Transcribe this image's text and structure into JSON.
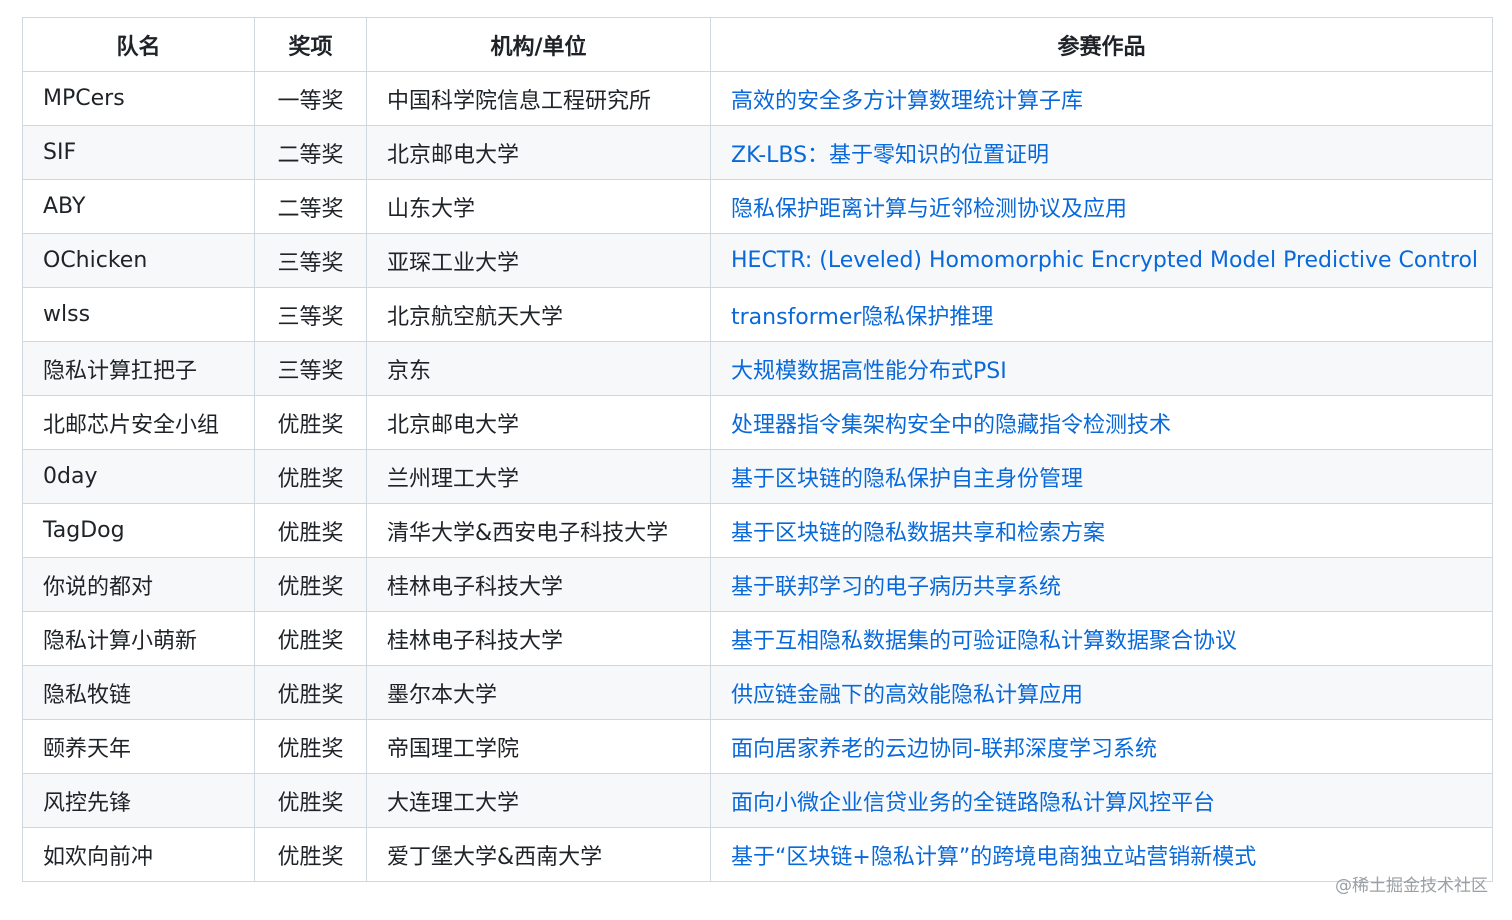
{
  "table": {
    "headers": [
      "队名",
      "奖项",
      "机构/单位",
      "参赛作品"
    ],
    "rows": [
      {
        "team": "MPCers",
        "award": "一等奖",
        "org": "中国科学院信息工程研究所",
        "work": "高效的安全多方计算数理统计算子库"
      },
      {
        "team": "SIF",
        "award": "二等奖",
        "org": "北京邮电大学",
        "work": "ZK-LBS：基于零知识的位置证明"
      },
      {
        "team": "ABY",
        "award": "二等奖",
        "org": "山东大学",
        "work": "隐私保护距离计算与近邻检测协议及应用"
      },
      {
        "team": "OChicken",
        "award": "三等奖",
        "org": "亚琛工业大学",
        "work": "HECTR: (Leveled) Homomorphic Encrypted Model Predictive Control"
      },
      {
        "team": "wlss",
        "award": "三等奖",
        "org": "北京航空航天大学",
        "work": "transformer隐私保护推理"
      },
      {
        "team": "隐私计算扛把子",
        "award": "三等奖",
        "org": "京东",
        "work": "大规模数据高性能分布式PSI"
      },
      {
        "team": "北邮芯片安全小组",
        "award": "优胜奖",
        "org": "北京邮电大学",
        "work": "处理器指令集架构安全中的隐藏指令检测技术"
      },
      {
        "team": "0day",
        "award": "优胜奖",
        "org": "兰州理工大学",
        "work": "基于区块链的隐私保护自主身份管理"
      },
      {
        "team": "TagDog",
        "award": "优胜奖",
        "org": "清华大学&西安电子科技大学",
        "work": "基于区块链的隐私数据共享和检索方案"
      },
      {
        "team": "你说的都对",
        "award": "优胜奖",
        "org": "桂林电子科技大学",
        "work": "基于联邦学习的电子病历共享系统"
      },
      {
        "team": "隐私计算小萌新",
        "award": "优胜奖",
        "org": "桂林电子科技大学",
        "work": "基于互相隐私数据集的可验证隐私计算数据聚合协议"
      },
      {
        "team": "隐私牧链",
        "award": "优胜奖",
        "org": "墨尔本大学",
        "work": "供应链金融下的高效能隐私计算应用"
      },
      {
        "team": "颐养天年",
        "award": "优胜奖",
        "org": "帝国理工学院",
        "work": "面向居家养老的云边协同-联邦深度学习系统"
      },
      {
        "team": "风控先锋",
        "award": "优胜奖",
        "org": "大连理工大学",
        "work": "面向小微企业信贷业务的全链路隐私计算风控平台"
      },
      {
        "team": "如欢向前冲",
        "award": "优胜奖",
        "org": "爱丁堡大学&西南大学",
        "work": "基于“区块链+隐私计算”的跨境电商独立站营销新模式"
      }
    ]
  },
  "watermark": "@稀土掘金技术社区",
  "colors": {
    "link": "#0969da",
    "border": "#d0d7de",
    "stripe": "#f6f8fa",
    "text": "#1f2328"
  }
}
